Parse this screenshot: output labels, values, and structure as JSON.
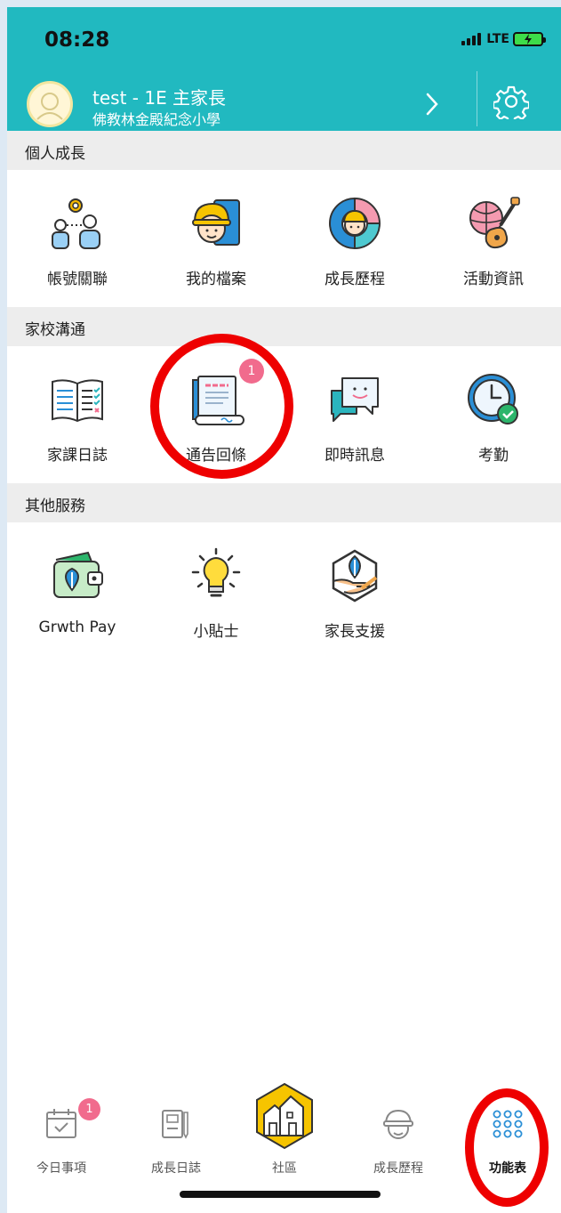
{
  "status_bar": {
    "time": "08:28",
    "network": "LTE"
  },
  "header": {
    "user_line": "test - 1E 主家長",
    "school": "佛教林金殿紀念小學"
  },
  "sections": [
    {
      "title": "個人成長",
      "items": [
        {
          "label": "帳號關聯",
          "icon": "account-link-icon"
        },
        {
          "label": "我的檔案",
          "icon": "my-profile-icon"
        },
        {
          "label": "成長歷程",
          "icon": "growth-path-icon"
        },
        {
          "label": "活動資訊",
          "icon": "activity-info-icon"
        }
      ]
    },
    {
      "title": "家校溝通",
      "items": [
        {
          "label": "家課日誌",
          "icon": "homework-diary-icon"
        },
        {
          "label": "通告回條",
          "icon": "notice-reply-icon",
          "badge": "1"
        },
        {
          "label": "即時訊息",
          "icon": "instant-message-icon"
        },
        {
          "label": "考勤",
          "icon": "attendance-clock-icon"
        }
      ]
    },
    {
      "title": "其他服務",
      "items": [
        {
          "label": "Grwth Pay",
          "icon": "wallet-icon"
        },
        {
          "label": "小貼士",
          "icon": "lightbulb-icon"
        },
        {
          "label": "家長支援",
          "icon": "parent-support-icon"
        }
      ]
    }
  ],
  "tabbar": [
    {
      "label": "今日事項",
      "icon": "calendar-check-icon",
      "badge": "1"
    },
    {
      "label": "成長日誌",
      "icon": "notebook-icon"
    },
    {
      "label": "社區",
      "icon": "community-houses-icon"
    },
    {
      "label": "成長歷程",
      "icon": "student-helmet-icon"
    },
    {
      "label": "功能表",
      "icon": "menu-grid-icon",
      "active": true
    }
  ],
  "colors": {
    "header_bg": "#21b9c0",
    "badge": "#f16b8d",
    "annotation": "#ee0000"
  }
}
